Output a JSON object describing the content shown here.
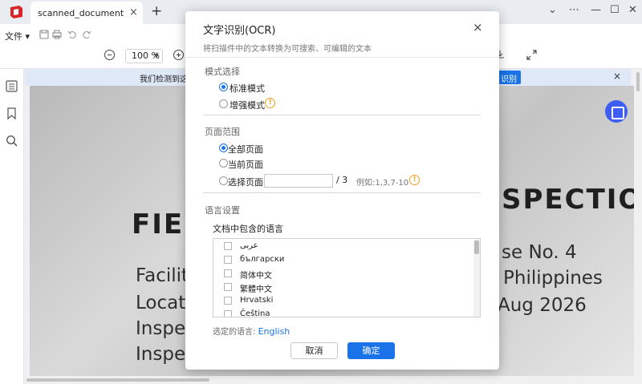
{
  "tab": {
    "title": "scanned_document",
    "close": "×",
    "add": "+"
  },
  "window_controls": {
    "chevron": "⌄",
    "more": "⋯",
    "minimize": "—",
    "maximize": "☐",
    "close": "✕"
  },
  "toolbar": {
    "file_menu": "文件",
    "zoom_value": "100 %"
  },
  "banner": {
    "text": "我们检测到这是",
    "button": "识别",
    "close": "×"
  },
  "document": {
    "heading_left": "FIE",
    "heading_right": "SPECTIO",
    "lines_left": [
      "Facilit",
      "Locat",
      "Inspe",
      "Inspe"
    ],
    "lines_right": [
      "se No. 4",
      "Philippines",
      "Aug 2026"
    ]
  },
  "dialog": {
    "title": "文字识别(OCR)",
    "subtitle": "将扫描件中的文本转换为可搜索、可编辑的文本",
    "close": "×",
    "mode_section": {
      "title": "模式选择",
      "options": [
        {
          "label": "标准模式",
          "selected": true
        },
        {
          "label": "增强模式",
          "selected": false
        }
      ]
    },
    "page_section": {
      "title": "页面范围",
      "options": [
        {
          "label": "全部页面",
          "selected": true
        },
        {
          "label": "当前页面",
          "selected": false
        },
        {
          "label": "选择页面",
          "selected": false
        }
      ],
      "page_input_value": "",
      "total": "/ 3",
      "example": "例如:1,3,7-10"
    },
    "language_section": {
      "title": "语言设置",
      "subtitle": "文档中包含的语言",
      "languages": [
        "عربى",
        "български",
        "简体中文",
        "繁體中文",
        "Hrvatski",
        "Čeština"
      ],
      "selected_label": "选定的语言:",
      "selected_value": "English"
    },
    "cancel_button": "取消",
    "ok_button": "确定"
  },
  "colors": {
    "accent": "#1a73e8",
    "warning": "#f0a020",
    "float_button": "#3d5ef0"
  }
}
